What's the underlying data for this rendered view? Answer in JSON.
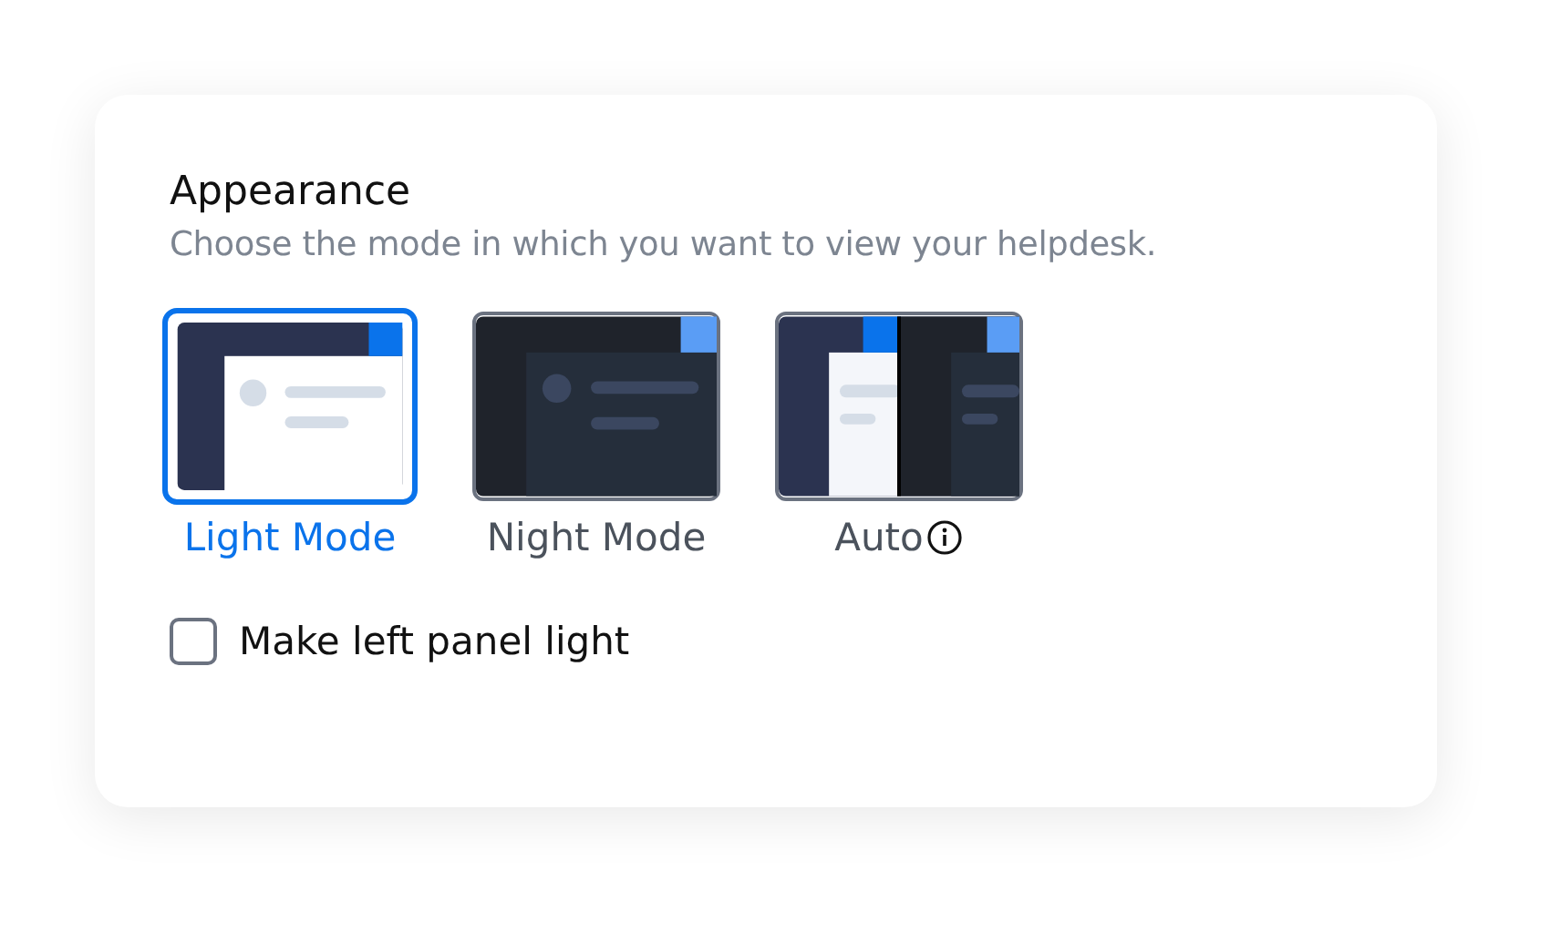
{
  "title": "Appearance",
  "subtitle": "Choose the mode in which you want to view your helpdesk.",
  "modes": [
    {
      "kind": "light",
      "label": "Light Mode",
      "selected": true
    },
    {
      "kind": "night",
      "label": "Night Mode",
      "selected": false
    },
    {
      "kind": "auto",
      "label": "Auto",
      "selected": false,
      "info": true
    }
  ],
  "option": {
    "label": "Make left panel light",
    "checked": false
  }
}
